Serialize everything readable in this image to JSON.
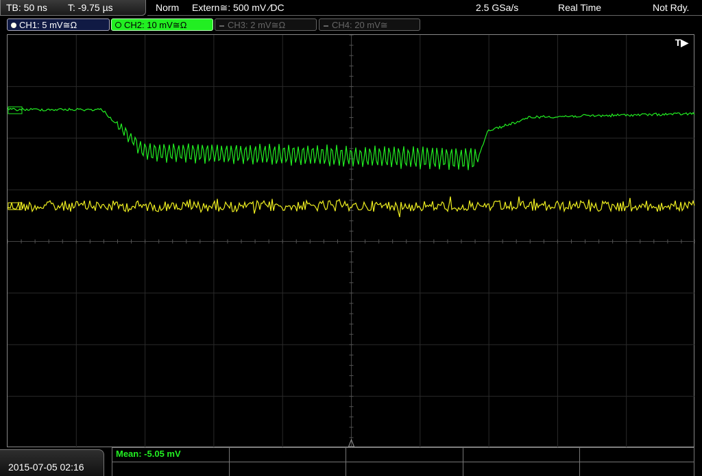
{
  "status": {
    "timebase": "TB: 50 ns",
    "trigger_time": "T: -9.75 µs",
    "mode": "Norm",
    "trigger_source": "Extern≅: 500 mV ⁄DC",
    "sample_rate": "2.5 GSa/s",
    "acquisition": "Real Time",
    "state": "Not Rdy."
  },
  "channels": [
    {
      "label": "CH1: 5 mV≅Ω",
      "color": "#ffffff",
      "active": true
    },
    {
      "label": "CH2: 10 mV≅Ω",
      "color": "#22ee22",
      "active": true,
      "selected": true
    },
    {
      "label": "CH3: 2 mV≅Ω",
      "color": "#666666",
      "active": false
    },
    {
      "label": "CH4: 20 mV≅",
      "color": "#666666",
      "active": false
    }
  ],
  "screen": {
    "trigger_marker": "T▶",
    "trace_colors": {
      "ch1": "#f0f020",
      "ch2": "#22ee22"
    }
  },
  "footer": {
    "datetime": "2015-07-05 02:16",
    "measurement": "Mean: -5.05 mV"
  }
}
